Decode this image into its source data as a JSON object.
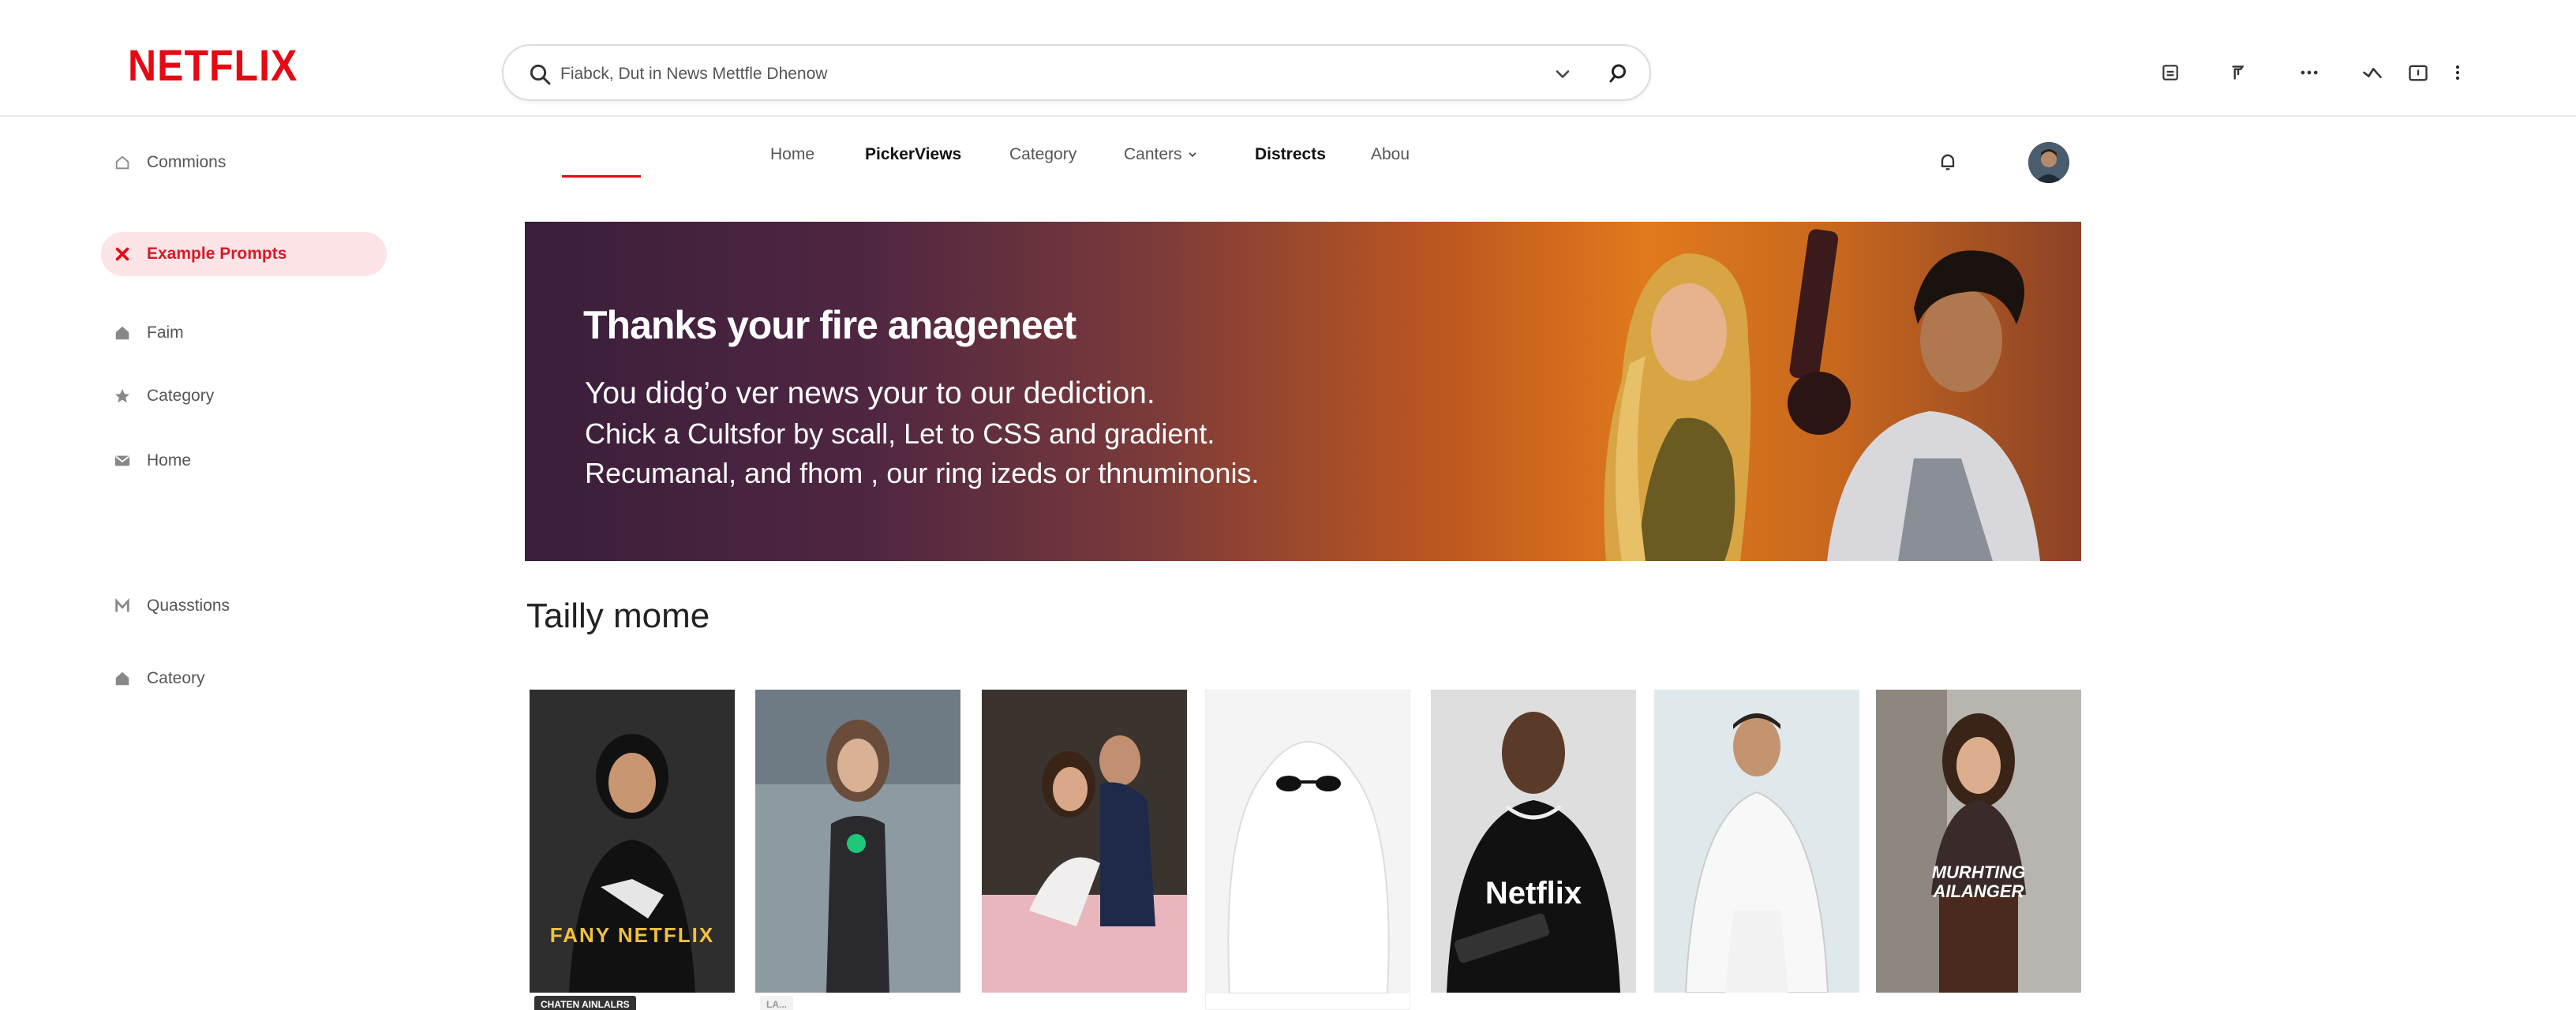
{
  "header": {
    "logo": "NETFLIX",
    "search_value": "Fiabck, Dut in News Mettfle Dhenow"
  },
  "sidebar": {
    "items": [
      {
        "label": "Commions",
        "icon": "home-icon"
      },
      {
        "label": "Example Prompts",
        "icon": "close-icon",
        "active": true
      },
      {
        "label": "Faim",
        "icon": "home-icon"
      },
      {
        "label": "Category",
        "icon": "star-icon"
      },
      {
        "label": "Home",
        "icon": "mail-icon"
      },
      {
        "label": "Quasstions",
        "icon": "m-icon"
      },
      {
        "label": "Cateory",
        "icon": "home-icon"
      }
    ]
  },
  "nav": {
    "items": [
      {
        "label": "Home"
      },
      {
        "label": "PickerViews",
        "bold": true
      },
      {
        "label": "Category"
      },
      {
        "label": "Canters",
        "dropdown": true
      },
      {
        "label": "Distrects",
        "bold": true
      },
      {
        "label": "Abou"
      }
    ]
  },
  "hero": {
    "title": "Thanks your fire anageneet",
    "line1": "You didg’o ver news your to our dediction.",
    "line2": "Chick a Cultsfor by scall, Let to CSS and gradient.",
    "line3": "Recumanal, and fhom , our ring izeds or thnuminonis."
  },
  "section": {
    "title": "Tailly mome",
    "cards": [
      {
        "text": "FANY NETFLIX",
        "tag": "CHATEN AINLALRS"
      },
      {
        "text": "",
        "tag": "LA..."
      },
      {
        "text": "",
        "tag": ""
      },
      {
        "text": "",
        "tag": ""
      },
      {
        "text": "Netflix",
        "tag": ""
      },
      {
        "text": "",
        "tag": ""
      },
      {
        "text": "MURHTING AILANGER",
        "tag": ""
      }
    ]
  },
  "colors": {
    "brand": "#e50914",
    "active_bg": "#fde4e6"
  }
}
